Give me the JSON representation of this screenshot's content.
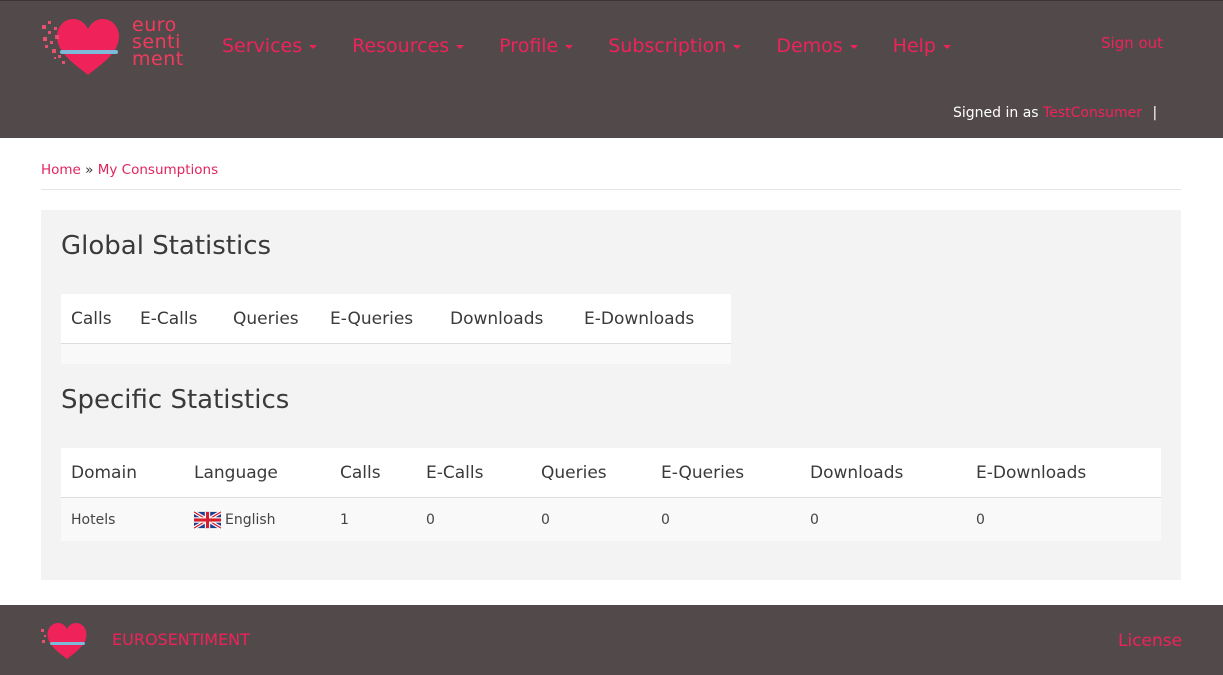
{
  "brand": {
    "logo_text_line1": "euro",
    "logo_text_line2": "senti",
    "logo_text_line3": "ment",
    "footer_name": "EUROSENTIMENT",
    "accent_color": "#f0225a",
    "header_bg": "#524a4a"
  },
  "nav": {
    "items": [
      {
        "label": "Services"
      },
      {
        "label": "Resources"
      },
      {
        "label": "Profile"
      },
      {
        "label": "Subscription"
      },
      {
        "label": "Demos"
      },
      {
        "label": "Help"
      }
    ],
    "sign_out": "Sign out",
    "signed_in_prefix": "Signed in as",
    "username": "TestConsumer",
    "separator": "|"
  },
  "breadcrumb": {
    "home": "Home",
    "separator": "»",
    "current": "My Consumptions"
  },
  "global_stats": {
    "title": "Global Statistics",
    "columns": [
      "Calls",
      "E-Calls",
      "Queries",
      "E-Queries",
      "Downloads",
      "E-Downloads"
    ],
    "rows": []
  },
  "specific_stats": {
    "title": "Specific Statistics",
    "columns": [
      "Domain",
      "Language",
      "Calls",
      "E-Calls",
      "Queries",
      "E-Queries",
      "Downloads",
      "E-Downloads"
    ],
    "rows": [
      {
        "domain": "Hotels",
        "language": "English",
        "flag_icon": "uk-flag-icon",
        "calls": "1",
        "e_calls": "0",
        "queries": "0",
        "e_queries": "0",
        "downloads": "0",
        "e_downloads": "0"
      }
    ]
  },
  "footer": {
    "license": "License"
  }
}
